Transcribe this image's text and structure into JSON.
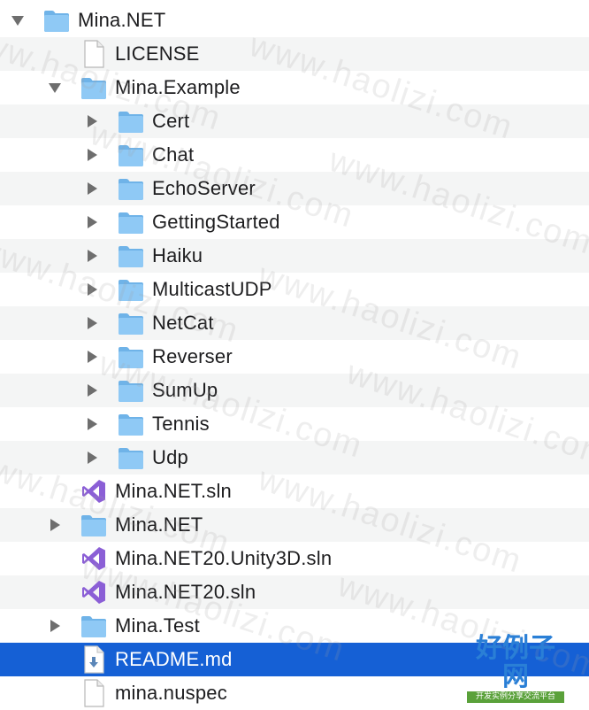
{
  "tree": {
    "rows": [
      {
        "label": "Mina.NET",
        "icon": "folder-icon",
        "disclosure": "expanded"
      },
      {
        "label": "LICENSE",
        "icon": "document-icon",
        "disclosure": "none"
      },
      {
        "label": "Mina.Example",
        "icon": "folder-icon",
        "disclosure": "expanded"
      },
      {
        "label": "Cert",
        "icon": "folder-icon",
        "disclosure": "collapsed"
      },
      {
        "label": "Chat",
        "icon": "folder-icon",
        "disclosure": "collapsed"
      },
      {
        "label": "EchoServer",
        "icon": "folder-icon",
        "disclosure": "collapsed"
      },
      {
        "label": "GettingStarted",
        "icon": "folder-icon",
        "disclosure": "collapsed"
      },
      {
        "label": "Haiku",
        "icon": "folder-icon",
        "disclosure": "collapsed"
      },
      {
        "label": "MulticastUDP",
        "icon": "folder-icon",
        "disclosure": "collapsed"
      },
      {
        "label": "NetCat",
        "icon": "folder-icon",
        "disclosure": "collapsed"
      },
      {
        "label": "Reverser",
        "icon": "folder-icon",
        "disclosure": "collapsed"
      },
      {
        "label": "SumUp",
        "icon": "folder-icon",
        "disclosure": "collapsed"
      },
      {
        "label": "Tennis",
        "icon": "folder-icon",
        "disclosure": "collapsed"
      },
      {
        "label": "Udp",
        "icon": "folder-icon",
        "disclosure": "collapsed"
      },
      {
        "label": "Mina.NET.sln",
        "icon": "visual-studio-solution-icon",
        "disclosure": "none"
      },
      {
        "label": "Mina.NET",
        "icon": "folder-icon",
        "disclosure": "collapsed"
      },
      {
        "label": "Mina.NET20.Unity3D.sln",
        "icon": "visual-studio-solution-icon",
        "disclosure": "none"
      },
      {
        "label": "Mina.NET20.sln",
        "icon": "visual-studio-solution-icon",
        "disclosure": "none"
      },
      {
        "label": "Mina.Test",
        "icon": "folder-icon",
        "disclosure": "collapsed"
      },
      {
        "label": "README.md",
        "icon": "markdown-document-icon",
        "disclosure": "none",
        "selected": true
      },
      {
        "label": "mina.nuspec",
        "icon": "document-icon",
        "disclosure": "none"
      }
    ]
  },
  "watermark": {
    "text": "www.haolizi.com",
    "badge_title": "好例子网",
    "badge_subtitle": "开发实例分享交流平台"
  },
  "colors": {
    "selection": "#1560d5",
    "alternate_row": "#f4f5f5",
    "folder": "#8fc9f5",
    "solution": "#8b5fd6"
  }
}
